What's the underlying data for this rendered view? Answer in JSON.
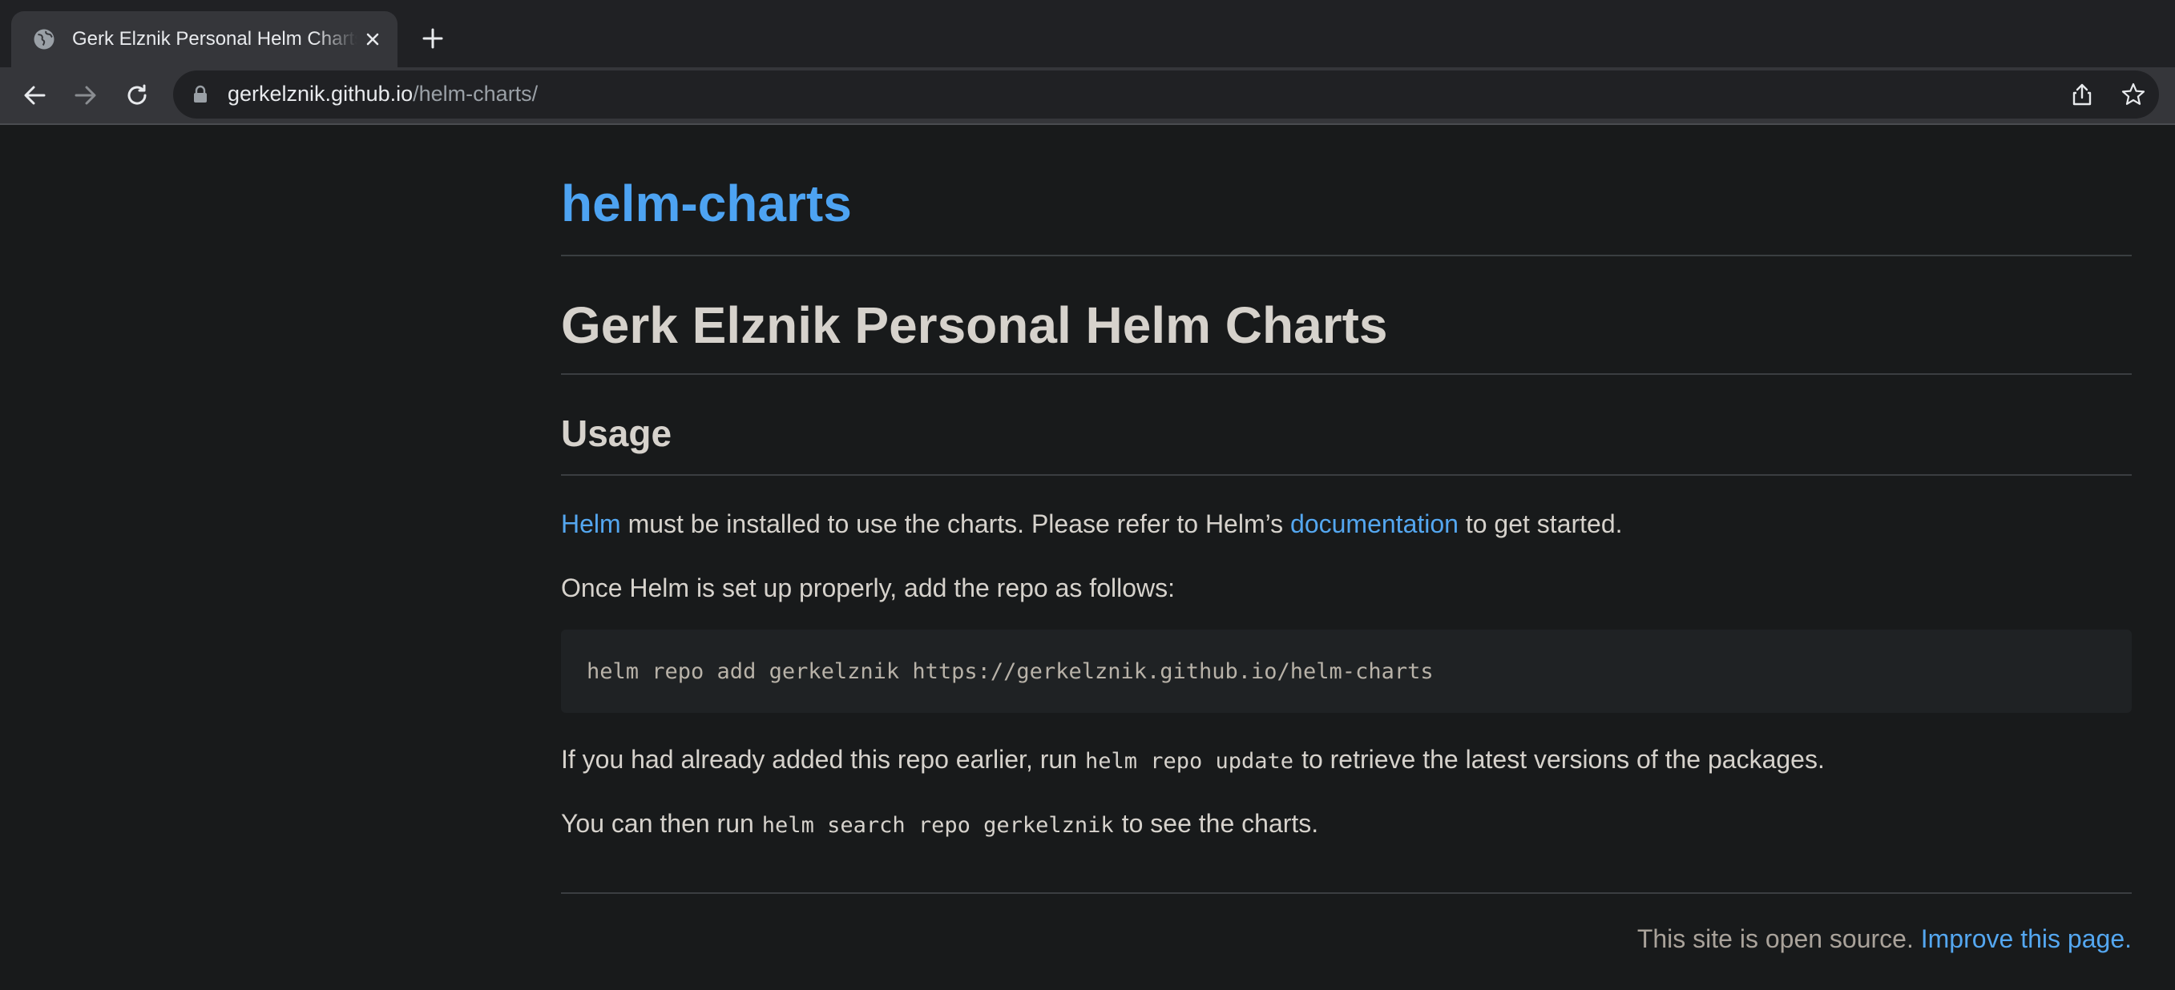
{
  "browser": {
    "tab_title": "Gerk Elznik Personal Helm Charts",
    "url_host": "gerkelznik.github.io",
    "url_path": "/helm-charts/"
  },
  "page": {
    "site_title": "helm-charts",
    "heading": "Gerk Elznik Personal Helm Charts",
    "usage_heading": "Usage",
    "para1": {
      "link_helm": "Helm",
      "text_mid": " must be installed to use the charts. Please refer to Helm’s ",
      "link_docs": "documentation",
      "text_end": " to get started."
    },
    "para2": "Once Helm is set up properly, add the repo as follows:",
    "code_block": "helm repo add gerkelznik https://gerkelznik.github.io/helm-charts",
    "para3": {
      "text_start": "If you had already added this repo earlier, run",
      "code": "helm repo update",
      "text_end": "to retrieve the latest versions of the packages."
    },
    "para4": {
      "text_start": "You can then run",
      "code": "helm search repo gerkelznik",
      "text_end": "to see the charts."
    },
    "footer": {
      "text": "This site is open source. ",
      "link": "Improve this page",
      "suffix": "."
    }
  },
  "colors": {
    "background": "#181a1b",
    "link": "#54a7f0",
    "text": "#d6d2cc"
  },
  "icons": [
    "globe-icon",
    "close-icon",
    "plus-icon",
    "back-arrow-icon",
    "forward-arrow-icon",
    "reload-icon",
    "lock-icon",
    "share-icon",
    "star-icon"
  ]
}
